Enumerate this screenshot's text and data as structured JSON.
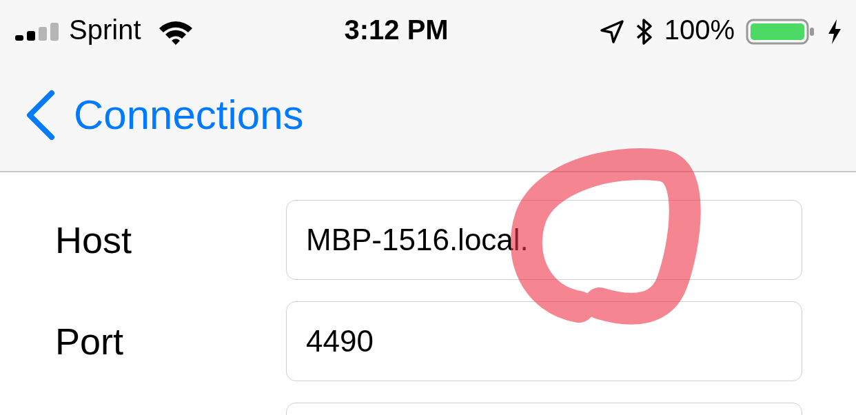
{
  "status_bar": {
    "carrier": "Sprint",
    "time": "3:12 PM",
    "battery": "100%",
    "charging": true
  },
  "nav_bar": {
    "back_label": "Connections"
  },
  "fields": [
    {
      "label": "Host",
      "value": "MBP-1516.local."
    },
    {
      "label": "Port",
      "value": "4490"
    }
  ]
}
